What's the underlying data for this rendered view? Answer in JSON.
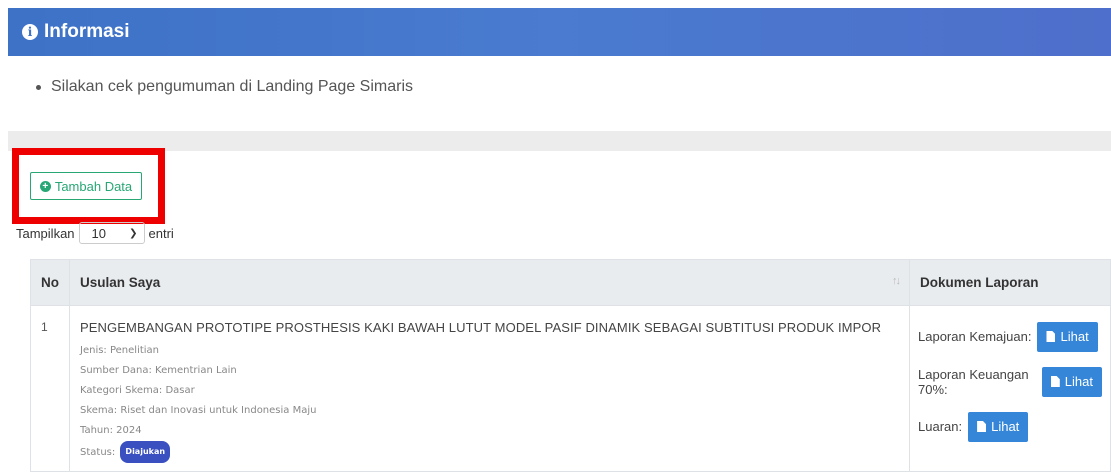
{
  "info": {
    "icon": "info-icon",
    "title": "Informasi",
    "bullets": [
      "Silakan cek pengumuman di Landing Page Simaris"
    ]
  },
  "toolbar": {
    "add_label": "Tambah Data",
    "add_icon": "plus-circle-icon"
  },
  "length_control": {
    "prefix": "Tampilkan",
    "value": "10",
    "suffix": "entri"
  },
  "table": {
    "headers": {
      "no": "No",
      "usulan": "Usulan Saya",
      "dokumen": "Dokumen Laporan"
    },
    "rows": [
      {
        "no": "1",
        "title": "PENGEMBANGAN PROTOTIPE PROSTHESIS KAKI BAWAH LUTUT MODEL PASIF DINAMIK SEBAGAI SUBTITUSI PRODUK IMPOR",
        "jenis": "Jenis: Penelitian",
        "sumber_dana": "Sumber Dana: Kementrian Lain",
        "kategori": "Kategori Skema: Dasar",
        "skema": "Skema: Riset dan Inovasi untuk Indonesia Maju",
        "tahun": "Tahun: 2024",
        "status_label": "Status:",
        "status_badge": "Diajukan",
        "docs": [
          {
            "label": "Laporan Kemajuan:",
            "button": "Lihat"
          },
          {
            "label": "Laporan Keuangan 70%:",
            "button": "Lihat"
          },
          {
            "label": "Luaran:",
            "button": "Lihat"
          }
        ]
      }
    ]
  },
  "colors": {
    "header_blue": "#3d72c6",
    "success_green": "#28a775",
    "primary_button": "#3586d8",
    "highlight_red": "#ee0000",
    "badge": "#3a50c0"
  }
}
